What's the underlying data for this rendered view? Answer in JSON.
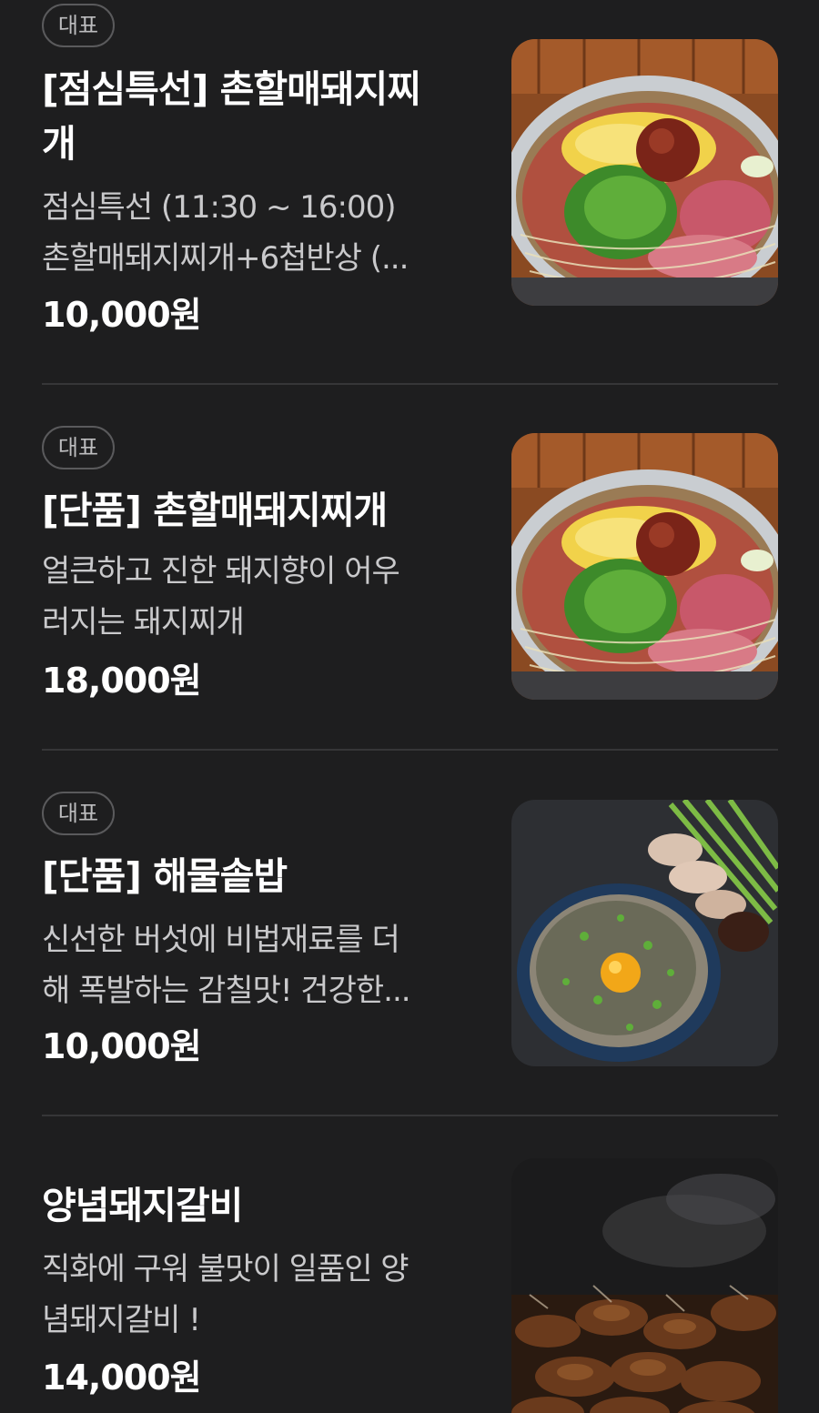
{
  "menu": {
    "items": [
      {
        "badge": "대표",
        "title_lines": [
          "[점심특선] 촌할매돼지찌",
          "개"
        ],
        "desc_lines": [
          "점심특선 (11:30 ~ 16:00)",
          "촌할매돼지찌개+6첩반상 (..."
        ],
        "price": "10,000원",
        "image_icon": "pork-stew-photo"
      },
      {
        "badge": "대표",
        "title_lines": [
          "[단품] 촌할매돼지찌개"
        ],
        "desc_lines": [
          "얼큰하고 진한 돼지향이 어우",
          "러지는 돼지찌개"
        ],
        "price": "18,000원",
        "image_icon": "pork-stew-photo"
      },
      {
        "badge": "대표",
        "title_lines": [
          "[단품] 해물솥밥"
        ],
        "desc_lines": [
          "신선한 버섯에 비법재료를 더",
          "해 폭발하는 감칠맛! 건강한..."
        ],
        "price": "10,000원",
        "image_icon": "seafood-pot-rice-photo"
      },
      {
        "title_lines": [
          "양념돼지갈비"
        ],
        "desc_lines": [
          "직화에 구워 불맛이 일품인 양",
          "념돼지갈비 !"
        ],
        "price": "14,000원",
        "image_icon": "grilled-pork-ribs-photo"
      }
    ]
  }
}
